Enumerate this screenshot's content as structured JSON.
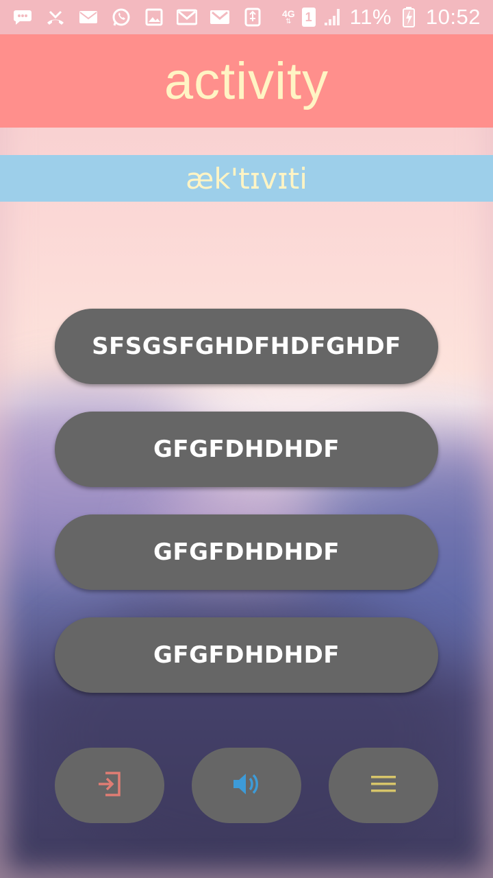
{
  "status_bar": {
    "time": "10:52",
    "battery": "11%",
    "network_type": "4G",
    "sim_slot": "1",
    "icons": [
      "messages-icon",
      "missed-call-icon",
      "email-icon",
      "whatsapp-icon",
      "gallery-icon",
      "gmail-icon",
      "gmail-icon",
      "usb-icon"
    ]
  },
  "header": {
    "title": "activity"
  },
  "phonetic": {
    "text": "æk'tɪvɪti"
  },
  "options": [
    {
      "label": "SFSGSFGHDFHDFGHDF"
    },
    {
      "label": "GFGFDHDHDF"
    },
    {
      "label": "GFGFDHDHDF"
    },
    {
      "label": "GFGFDHDHDF"
    }
  ],
  "toolbar": {
    "exit_icon": "exit-icon",
    "sound_icon": "speaker-icon",
    "menu_icon": "menu-icon",
    "colors": {
      "exit": "#e07d74",
      "sound": "#3d9bd8",
      "menu": "#d7c56a"
    }
  },
  "colors": {
    "header_bg": "#ff8f8c",
    "title_text": "#fff4c4",
    "phonetic_bg": "#9dcfea",
    "button_bg": "#666666"
  }
}
